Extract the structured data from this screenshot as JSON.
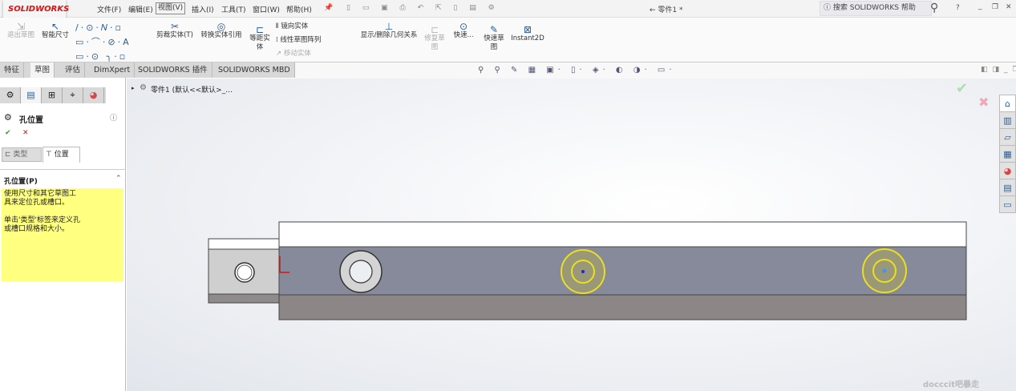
{
  "app": {
    "logo": "SOLIDWORKS",
    "title": "← 零件1 *",
    "search_placeholder": "搜索 SOLIDWORKS 帮助"
  },
  "menu": [
    "文件(F)",
    "编辑(E)",
    "视图(V)",
    "插入(I)",
    "工具(T)",
    "窗口(W)",
    "帮助(H)"
  ],
  "ribbon": {
    "exit_sketch": "退出草图",
    "smart_dim": "智能尺寸",
    "trim": "剪裁实体(T)",
    "convert": "转换实体引用",
    "offset": "等距实\n体",
    "mirror": "镜向实体",
    "linear_pattern": "线性草图阵列",
    "move": "移动实体",
    "relations": "显示/删除几何关系",
    "repair": "修复草\n图",
    "quick": "快速...",
    "quick_sketch": "快速草\n图",
    "instant2d": "Instant2D"
  },
  "tabs": [
    "特征",
    "草图",
    "评估",
    "DimXpert",
    "SOLIDWORKS 插件",
    "SOLIDWORKS MBD"
  ],
  "active_tab": 1,
  "tree": {
    "root": "零件1  (默认<<默认>_..."
  },
  "property_manager": {
    "title": "孔位置",
    "tab_type": "类型",
    "tab_position": "位置",
    "section": "孔位置(P)",
    "note": "使用尺寸和其它草图工\n具来定位孔或槽口。\n\n单击'类型'标签来定义孔\n或槽口规格和大小。"
  },
  "colors": {
    "accent": "#d11a1a",
    "highlight": "#e8e020",
    "note_bg": "#ffff80",
    "face": "#878a9a"
  },
  "watermark": "docccit吧暴走"
}
